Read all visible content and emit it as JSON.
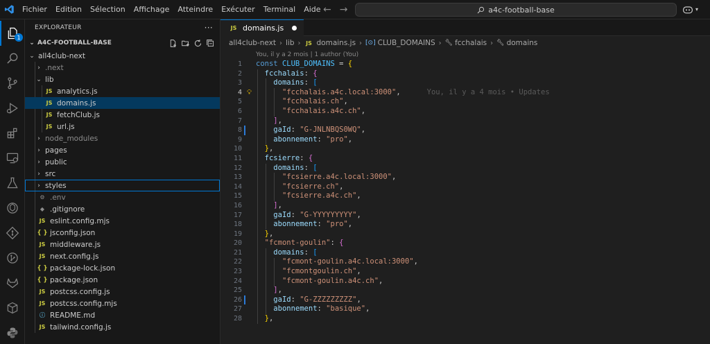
{
  "menu": [
    "Fichier",
    "Edition",
    "Sélection",
    "Affichage",
    "Atteindre",
    "Exécuter",
    "Terminal",
    "Aide"
  ],
  "search": {
    "text": "a4c-football-base"
  },
  "activity": {
    "badge": "1"
  },
  "sidebar": {
    "title": "EXPLORATEUR",
    "more": "···",
    "section": "A4C-FOOTBALL-BASE",
    "tree": [
      {
        "label": "all4club-next",
        "type": "folder",
        "open": true,
        "depth": 1
      },
      {
        "label": ".next",
        "type": "folder",
        "open": false,
        "depth": 2,
        "dim": true
      },
      {
        "label": "lib",
        "type": "folder",
        "open": true,
        "depth": 2
      },
      {
        "label": "analytics.js",
        "type": "js",
        "depth": 3
      },
      {
        "label": "domains.js",
        "type": "js",
        "depth": 3,
        "selected": true
      },
      {
        "label": "fetchClub.js",
        "type": "js",
        "depth": 3
      },
      {
        "label": "url.js",
        "type": "js",
        "depth": 3
      },
      {
        "label": "node_modules",
        "type": "folder",
        "open": false,
        "depth": 2,
        "dim": true
      },
      {
        "label": "pages",
        "type": "folder",
        "open": false,
        "depth": 2
      },
      {
        "label": "public",
        "type": "folder",
        "open": false,
        "depth": 2
      },
      {
        "label": "src",
        "type": "folder",
        "open": false,
        "depth": 2
      },
      {
        "label": "styles",
        "type": "folder",
        "open": false,
        "depth": 2,
        "focused": true
      },
      {
        "label": ".env",
        "type": "env",
        "depth": 2,
        "dim": true
      },
      {
        "label": ".gitignore",
        "type": "git",
        "depth": 2
      },
      {
        "label": "eslint.config.mjs",
        "type": "js",
        "depth": 2
      },
      {
        "label": "jsconfig.json",
        "type": "json",
        "depth": 2
      },
      {
        "label": "middleware.js",
        "type": "js",
        "depth": 2
      },
      {
        "label": "next.config.js",
        "type": "js",
        "depth": 2
      },
      {
        "label": "package-lock.json",
        "type": "json",
        "depth": 2
      },
      {
        "label": "package.json",
        "type": "json",
        "depth": 2
      },
      {
        "label": "postcss.config.js",
        "type": "js",
        "depth": 2
      },
      {
        "label": "postcss.config.mjs",
        "type": "js",
        "depth": 2
      },
      {
        "label": "README.md",
        "type": "info",
        "depth": 2
      },
      {
        "label": "tailwind.config.js",
        "type": "js",
        "depth": 2
      }
    ]
  },
  "editor": {
    "tab": {
      "icon": "JS",
      "label": "domains.js"
    },
    "breadcrumbs": [
      "all4club-next",
      "lib",
      "domains.js",
      "CLUB_DOMAINS",
      "fcchalais",
      "domains"
    ],
    "blame_header": "You, il y a 2 mois | 1 author (You)",
    "inline_blame": "You, il y a 4 mois • Updates",
    "lines": [
      {
        "n": "1",
        "text": "const CLUB_DOMAINS = {"
      },
      {
        "n": "2",
        "text": "  fcchalais: {"
      },
      {
        "n": "3",
        "text": "    domains: ["
      },
      {
        "n": "4",
        "text": "      \"fcchalais.a4c.local:3000\","
      },
      {
        "n": "5",
        "text": "      \"fcchalais.ch\","
      },
      {
        "n": "6",
        "text": "      \"fcchalais.a4c.ch\","
      },
      {
        "n": "7",
        "text": "    ],"
      },
      {
        "n": "8",
        "text": "    gaId: \"G-JNLNBQS0WQ\","
      },
      {
        "n": "9",
        "text": "    abonnement: \"pro\","
      },
      {
        "n": "10",
        "text": "  },"
      },
      {
        "n": "11",
        "text": "  fcsierre: {"
      },
      {
        "n": "12",
        "text": "    domains: ["
      },
      {
        "n": "13",
        "text": "      \"fcsierre.a4c.local:3000\","
      },
      {
        "n": "14",
        "text": "      \"fcsierre.ch\","
      },
      {
        "n": "15",
        "text": "      \"fcsierre.a4c.ch\","
      },
      {
        "n": "16",
        "text": "    ],"
      },
      {
        "n": "17",
        "text": "    gaId: \"G-YYYYYYYYY\","
      },
      {
        "n": "18",
        "text": "    abonnement: \"pro\","
      },
      {
        "n": "19",
        "text": "  },"
      },
      {
        "n": "20",
        "text": "  \"fcmont-goulin\": {"
      },
      {
        "n": "21",
        "text": "    domains: ["
      },
      {
        "n": "22",
        "text": "      \"fcmont-goulin.a4c.local:3000\","
      },
      {
        "n": "23",
        "text": "      \"fcmontgoulin.ch\","
      },
      {
        "n": "24",
        "text": "      \"fcmont-goulin.a4c.ch\","
      },
      {
        "n": "25",
        "text": "    ],"
      },
      {
        "n": "26",
        "text": "    gaId: \"G-ZZZZZZZZZ\","
      },
      {
        "n": "27",
        "text": "    abonnement: \"basique\","
      },
      {
        "n": "28",
        "text": "  },"
      }
    ]
  },
  "colors": {
    "accent": "#0078d4",
    "selection": "#04395e",
    "background": "#1f1f1f"
  }
}
